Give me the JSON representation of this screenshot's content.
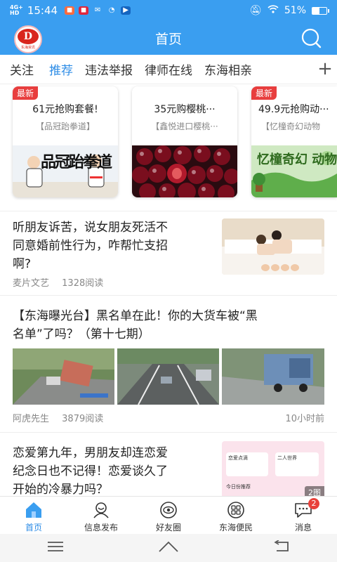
{
  "status_bar": {
    "network": [
      "4G+",
      "HD"
    ],
    "time": "15:44",
    "battery": "51%",
    "battery_level": 0.51
  },
  "header": {
    "title": "首页",
    "logo_text": "D",
    "logo_sub": "东海资讯"
  },
  "tabs": [
    {
      "label": "关注",
      "active": false
    },
    {
      "label": "推荐",
      "active": true
    },
    {
      "label": "违法举报",
      "active": false
    },
    {
      "label": "律师在线",
      "active": false
    },
    {
      "label": "东海相亲",
      "active": false
    }
  ],
  "promos": [
    {
      "badge": "最新",
      "title": "61元抢购套餐!",
      "shop": "【品冠跆拳道】",
      "image_text": "品冠跆拳道"
    },
    {
      "badge": "",
      "title": "35元购樱桃···",
      "shop": "【鑫悦进口樱桃···",
      "image_text": ""
    },
    {
      "badge": "最新",
      "title": "49.9元抢购动···",
      "shop": "【忆橦奇幻动物",
      "image_text": "忆橦奇幻 动物王国"
    }
  ],
  "articles": [
    {
      "title_lines": [
        "听朋友诉苦，说女朋友死活不",
        "同意婚前性行为，咋帮忙支招",
        "啊?"
      ],
      "author": "麦片文艺",
      "reads": "1328阅读"
    },
    {
      "title_lines": [
        "【东海曝光台】黑名单在此！你的大货车被“黑",
        "名单”了吗？（第十七期）"
      ],
      "author": "阿虎先生",
      "reads": "3879阅读",
      "time": "10小时前"
    },
    {
      "title_lines": [
        "恋爱第九年，男朋友却连恋爱",
        "纪念日也不记得！恋爱谈久了",
        "开始的冷暴力吗？"
      ],
      "image_count": "2图",
      "thumb_texts": [
        "恋爱点滴",
        "二人世界",
        "今日份推荐"
      ]
    }
  ],
  "tabbar": [
    {
      "label": "首页",
      "icon": "home-icon",
      "active": true
    },
    {
      "label": "信息发布",
      "icon": "publish-icon",
      "active": false
    },
    {
      "label": "好友圈",
      "icon": "friends-icon",
      "active": false
    },
    {
      "label": "东海便民",
      "icon": "services-icon",
      "active": false
    },
    {
      "label": "消息",
      "icon": "message-icon",
      "active": false,
      "badge": "2"
    }
  ],
  "colors": {
    "primary": "#3a9ef0",
    "active_tab": "#2d8ce6",
    "badge_red": "#e83e3e"
  }
}
